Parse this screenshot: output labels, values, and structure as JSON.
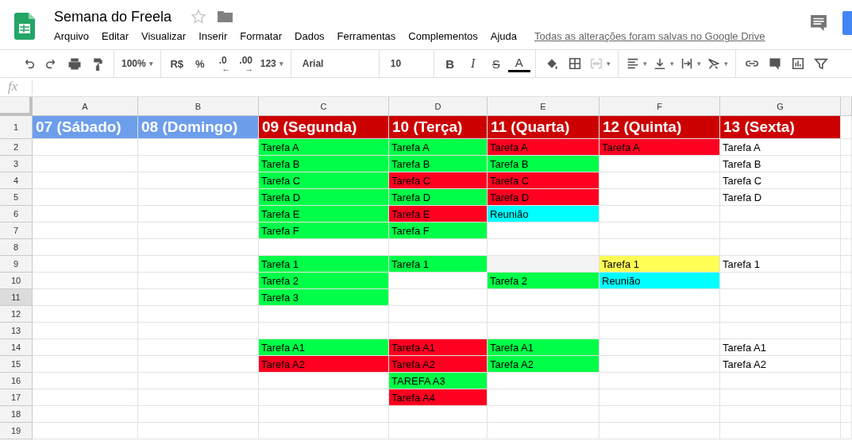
{
  "document": {
    "title": "Semana do Freela",
    "starred": false,
    "save_status": "Todas as alterações foram salvas no Google Drive"
  },
  "menu": [
    "Arquivo",
    "Editar",
    "Visualizar",
    "Inserir",
    "Formatar",
    "Dados",
    "Ferramentas",
    "Complementos",
    "Ajuda"
  ],
  "toolbar": [
    [
      {
        "kind": "undo"
      },
      {
        "kind": "redo"
      },
      {
        "kind": "print"
      },
      {
        "kind": "paint"
      }
    ],
    [
      {
        "kind": "menu",
        "text": "100%",
        "caret": "▾"
      }
    ],
    [
      {
        "kind": "text",
        "text": "R$"
      },
      {
        "kind": "text",
        "text": "%"
      },
      {
        "kind": "decimal",
        "text": ".0",
        "arrow": "←"
      },
      {
        "kind": "decimal",
        "text": ".00",
        "arrow": "→"
      },
      {
        "kind": "caret-text",
        "text": "123",
        "caret": "▾"
      }
    ],
    [
      {
        "kind": "select",
        "text": "Arial"
      }
    ],
    [
      {
        "kind": "select-small",
        "text": "10"
      }
    ],
    [
      {
        "kind": "bold",
        "text": "B"
      },
      {
        "kind": "italic",
        "text": "I"
      },
      {
        "kind": "strike",
        "text": "S"
      },
      {
        "kind": "textcolor",
        "text": "A"
      }
    ],
    [
      {
        "kind": "fill"
      },
      {
        "kind": "borders"
      },
      {
        "kind": "merge",
        "disabled": true,
        "caret": "▾"
      }
    ],
    [
      {
        "kind": "halign",
        "caret": "▾"
      },
      {
        "kind": "valign",
        "caret": "▾"
      },
      {
        "kind": "wrap",
        "caret": "▾"
      },
      {
        "kind": "rotate",
        "caret": "▾"
      }
    ],
    [
      {
        "kind": "link"
      },
      {
        "kind": "comment"
      },
      {
        "kind": "chart"
      },
      {
        "kind": "filter"
      }
    ]
  ],
  "formula_bar": {
    "label": "fx"
  },
  "columns": [
    "A",
    "B",
    "C",
    "D",
    "E",
    "F",
    "G"
  ],
  "rows": [
    {
      "number": "1",
      "kind": "header",
      "selected": false,
      "cells": [
        {
          "text": "07 (Sábado)",
          "color": "#6d9eeb"
        },
        {
          "text": "08 (Domingo)",
          "color": "#6d9eeb"
        },
        {
          "text": "09 (Segunda)",
          "color": "#cc0000"
        },
        {
          "text": "10 (Terça)",
          "color": "#cc0000"
        },
        {
          "text": "11 (Quarta)",
          "color": "#cc0000"
        },
        {
          "text": "12 (Quinta)",
          "color": "#cc0000"
        },
        {
          "text": "13 (Sexta)",
          "color": "#cc0000"
        }
      ]
    },
    {
      "number": "2",
      "kind": "plain",
      "selected": false,
      "cells": [
        {},
        {},
        {
          "text": "Tarefa A",
          "color": "#00ff48"
        },
        {
          "text": "Tarefa A",
          "color": "#00ff48"
        },
        {
          "text": "Tarefa A",
          "color": "#ff0021"
        },
        {
          "text": "Tarefa A",
          "color": "#ff0021"
        },
        {
          "text": "Tarefa A"
        }
      ]
    },
    {
      "number": "3",
      "kind": "plain",
      "selected": false,
      "cells": [
        {},
        {},
        {
          "text": "Tarefa B",
          "color": "#00ff48"
        },
        {
          "text": "Tarefa B",
          "color": "#00ff48"
        },
        {
          "text": "Tarefa B",
          "color": "#00ff48"
        },
        {},
        {
          "text": "Tarefa B"
        }
      ]
    },
    {
      "number": "4",
      "kind": "plain",
      "selected": false,
      "cells": [
        {},
        {},
        {
          "text": "Tarefa C",
          "color": "#00ff48"
        },
        {
          "text": "Tarefa C",
          "color": "#ff0021"
        },
        {
          "text": "Tarefa C",
          "color": "#ff0021"
        },
        {},
        {
          "text": "Tarefa C"
        }
      ]
    },
    {
      "number": "5",
      "kind": "plain",
      "selected": false,
      "cells": [
        {},
        {},
        {
          "text": "Tarefa D",
          "color": "#00ff48"
        },
        {
          "text": "Tarefa D",
          "color": "#00ff48"
        },
        {
          "text": "Tarefa D",
          "color": "#ff0021"
        },
        {},
        {
          "text": "Tarefa D"
        }
      ]
    },
    {
      "number": "6",
      "kind": "plain",
      "selected": false,
      "cells": [
        {},
        {},
        {
          "text": "Tarefa E",
          "color": "#00ff48"
        },
        {
          "text": "Tarefa E",
          "color": "#ff0021"
        },
        {
          "text": "Reunião",
          "color": "#00ffff"
        }
      ]
    },
    {
      "number": "7",
      "kind": "plain",
      "selected": false,
      "cells": [
        {},
        {},
        {
          "text": "Tarefa F",
          "color": "#00ff48"
        },
        {
          "text": "Tarefa F",
          "color": "#00ff48"
        }
      ]
    },
    {
      "number": "8",
      "kind": "plain",
      "selected": false
    },
    {
      "number": "9",
      "kind": "plain",
      "selected": false,
      "cells": [
        {},
        {},
        {
          "text": "Tarefa 1",
          "color": "#00ff48"
        },
        {
          "text": "Tarefa 1",
          "color": "#00ff48"
        },
        {
          "color": "#f3f3f3"
        },
        {
          "text": "Tarefa 1",
          "color": "#ffff55"
        },
        {
          "text": "Tarefa 1"
        }
      ]
    },
    {
      "number": "10",
      "kind": "plain",
      "selected": false,
      "cells": [
        {},
        {},
        {
          "text": "Tarefa 2",
          "color": "#00ff48"
        },
        {},
        {
          "text": "Tarefa 2",
          "color": "#00ff48"
        },
        {
          "text": "Reunião",
          "color": "#00ffff"
        }
      ]
    },
    {
      "number": "11",
      "kind": "plain",
      "selected": true,
      "cells": [
        {},
        {},
        {
          "text": "Tarefa 3",
          "color": "#00ff48"
        }
      ]
    },
    {
      "number": "12",
      "kind": "plain",
      "selected": false
    },
    {
      "number": "13",
      "kind": "plain",
      "selected": false
    },
    {
      "number": "14",
      "kind": "plain",
      "selected": false,
      "cells": [
        {},
        {},
        {
          "text": "Tarefa A1",
          "color": "#00ff48"
        },
        {
          "text": "Tarefa A1",
          "color": "#ff0021"
        },
        {
          "text": "Tarefa A1",
          "color": "#00ff48"
        },
        {},
        {
          "text": "Tarefa A1"
        }
      ]
    },
    {
      "number": "15",
      "kind": "plain",
      "selected": false,
      "cells": [
        {},
        {},
        {
          "text": "Tarefa A2",
          "color": "#ff0021"
        },
        {
          "text": "Tarefa A2",
          "color": "#ff0021"
        },
        {
          "text": "Tarefa A2",
          "color": "#00ff48"
        },
        {},
        {
          "text": "Tarefa A2"
        }
      ]
    },
    {
      "number": "16",
      "kind": "plain",
      "selected": false,
      "cells": [
        {},
        {},
        {},
        {
          "text": "TAREFA A3",
          "color": "#00ff48"
        }
      ]
    },
    {
      "number": "17",
      "kind": "plain",
      "selected": false,
      "cells": [
        {},
        {},
        {},
        {
          "text": "Tarefa A4",
          "color": "#ff0021"
        }
      ]
    },
    {
      "number": "18",
      "kind": "plain",
      "selected": false
    },
    {
      "number": "19",
      "kind": "plain",
      "selected": false
    }
  ]
}
